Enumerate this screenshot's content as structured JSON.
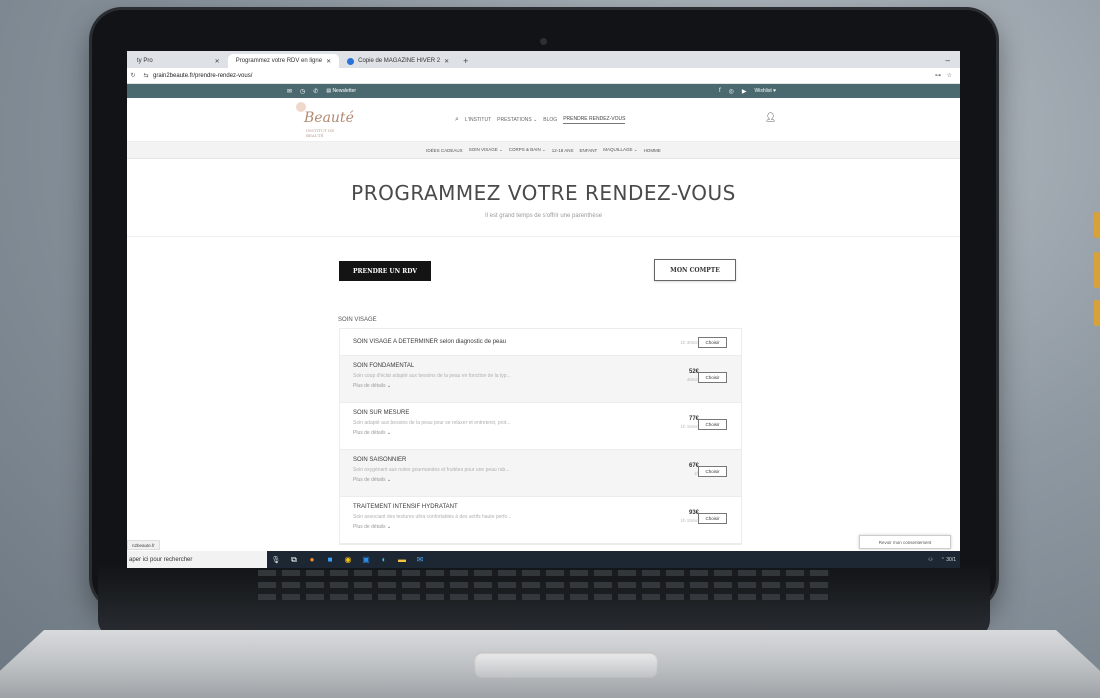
{
  "browser": {
    "tabs": [
      {
        "label": "ty Pro",
        "active": false
      },
      {
        "label": "Programmez votre RDV en ligne",
        "active": true
      },
      {
        "label": "Copie de MAGAZINE HIVER 2",
        "active": false
      }
    ],
    "newtab": "+",
    "minimize": "–",
    "url": "grain2beaute.fr/prendre-rendez-vous/",
    "right_icons": "⊶ ☆"
  },
  "topbar": {
    "newsletter": "Newsletter",
    "wishlist": "Wishlist"
  },
  "logo": {
    "text": "Beauté",
    "tagline": "INSTITUT DE BEAUTÉ"
  },
  "nav": {
    "items": [
      "L'INSTITUT",
      "PRESTATIONS ⌄",
      "BLOG",
      "PRENDRE RENDEZ-VOUS"
    ]
  },
  "categories": [
    "IDÉES CADEAUX",
    "SOIN VISAGE ⌄",
    "CORPS & BAIN ⌄",
    "12-18 ANS",
    "ENFANT",
    "MAQUILLAGE ⌄",
    "HOMME"
  ],
  "hero": {
    "title": "PROGRAMMEZ VOTRE RENDEZ-VOUS",
    "subtitle": "Il est grand temps de s'offrir une parenthèse"
  },
  "actions": {
    "book": "PRENDRE UN RDV",
    "account": "MON COMPTE"
  },
  "section": "SOIN VISAGE",
  "services": [
    {
      "name": "SOIN VISAGE A DETERMINER selon diagnostic de peau",
      "desc": "",
      "more": "",
      "price": "",
      "duration": "1h 30min",
      "choose": "Choisir"
    },
    {
      "name": "SOIN FONDAMENTAL",
      "desc": "Soin coup d'éclat adapté aux besoins de la peau en fonction de la typ...",
      "more": "Plus de détails",
      "price": "52€",
      "duration": "45min",
      "choose": "Choisir"
    },
    {
      "name": "SOIN SUR MESURE",
      "desc": "Soin adapté aux besoins de la peau pour se relaxer et entretenir, prot...",
      "more": "Plus de détails",
      "price": "77€",
      "duration": "1h 15min",
      "choose": "Choisir"
    },
    {
      "name": "SOIN SAISONNIER",
      "desc": "Soin oxygénant aux notes gourmandes et fruitées pour une peau rab...",
      "more": "Plus de détails",
      "price": "67€",
      "duration": "1h",
      "choose": "Choisir"
    },
    {
      "name": "TRAITEMENT INTENSIF HYDRATANT",
      "desc": "Soin associant des textures ultra confortables à des actifs haute perfo...",
      "more": "Plus de détails",
      "price": "93€",
      "duration": "1h 15min",
      "choose": "Choisir"
    }
  ],
  "status_url": "n2beaute.fr",
  "consent": "Revoir mon consentement",
  "taskbar": {
    "search": "aper ici pour rechercher",
    "tray": "⌃ 30/1"
  },
  "colors": {
    "topbar": "#4a6a6f",
    "primary_button": "#141414",
    "taskbar": "#1c2733"
  }
}
